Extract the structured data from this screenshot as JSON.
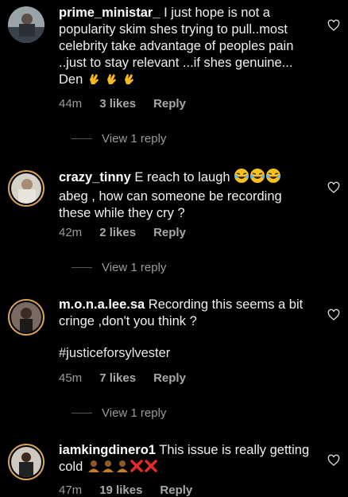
{
  "comments": [
    {
      "username": "prime_ministar_",
      "text": " I just hope is not a popularity skim shes trying to pull..most celebrity take advantage of peoples pain ..just to stay relevant ...if shes genuine... Den ",
      "emojis": [
        "clap",
        "clap",
        "clap"
      ],
      "time": "44m",
      "likes": "3 likes",
      "reply": "Reply",
      "view_replies": "View 1 reply"
    },
    {
      "username": "crazy_tinny",
      "text": " E reach to laugh ",
      "text_after": "abeg , how can someone be recording these while they cry ?",
      "emojis": [
        "laugh",
        "laugh",
        "laugh"
      ],
      "time": "42m",
      "likes": "2 likes",
      "reply": "Reply",
      "view_replies": "View 1 reply"
    },
    {
      "username": "m.o.n.a.lee.sa",
      "text": " Recording this seems a bit cringe ,don't you think ?",
      "hashtag": "#justiceforsylvester",
      "time": "45m",
      "likes": "7 likes",
      "reply": "Reply",
      "view_replies": "View 1 reply"
    },
    {
      "username": "iamkingdinero1",
      "text": " This issue is really getting cold ",
      "emojis": [
        "person",
        "person",
        "person",
        "x",
        "x"
      ],
      "time": "47m",
      "likes": "19 likes",
      "reply": "Reply"
    }
  ],
  "colors": {
    "background": "#000000",
    "meta": "#9a9a9a",
    "avatar_ring": "#d9a45a"
  }
}
